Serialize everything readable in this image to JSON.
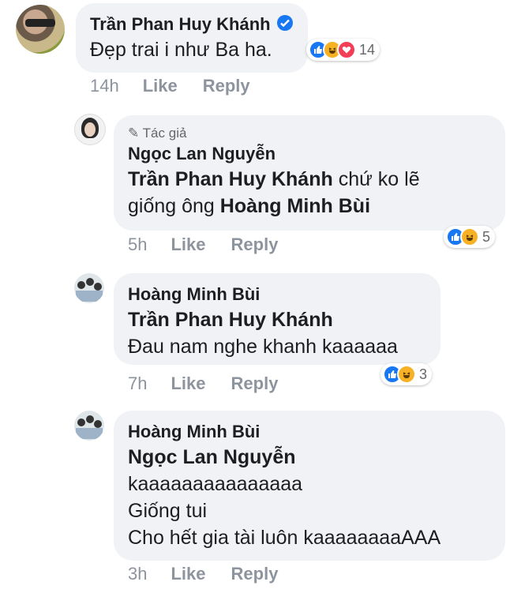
{
  "comments": [
    {
      "author": "Trần Phan Huy Khánh",
      "text": "Đẹp trai i như Ba ha.",
      "time": "14h",
      "like": "Like",
      "reply": "Reply",
      "reaction_count": "14",
      "reactions": [
        "like-icon",
        "haha-icon",
        "love-icon"
      ]
    },
    {
      "badge": "Tác giả",
      "author": "Ngọc Lan Nguyễn",
      "mention1": "Trần Phan Huy Khánh",
      "text1": " chứ ko lẽ",
      "text2": "giống ông ",
      "mention2": "Hoàng Minh Bùi",
      "time": "5h",
      "like": "Like",
      "reply": "Reply",
      "reaction_count": "5",
      "reactions": [
        "like-icon",
        "haha-icon"
      ]
    },
    {
      "author": "Hoàng Minh Bùi",
      "mention": "Trần Phan Huy Khánh",
      "text": "Đau nam nghe khanh kaaaaaa",
      "time": "7h",
      "like": "Like",
      "reply": "Reply",
      "reaction_count": "3",
      "reactions": [
        "like-icon",
        "haha-icon"
      ]
    },
    {
      "author": "Hoàng Minh Bùi",
      "mention": "Ngọc Lan Nguyễn",
      "line1": "kaaaaaaaaaaaaaaa",
      "line2": "Giống tui",
      "line3": "Cho hết gia tài luôn kaaaaaaaaAAA",
      "time": "3h",
      "like": "Like",
      "reply": "Reply"
    }
  ],
  "colors": {
    "like": "#1877f2",
    "haha": "#f7b125",
    "love": "#f33e58",
    "verified": "#1877f2"
  }
}
